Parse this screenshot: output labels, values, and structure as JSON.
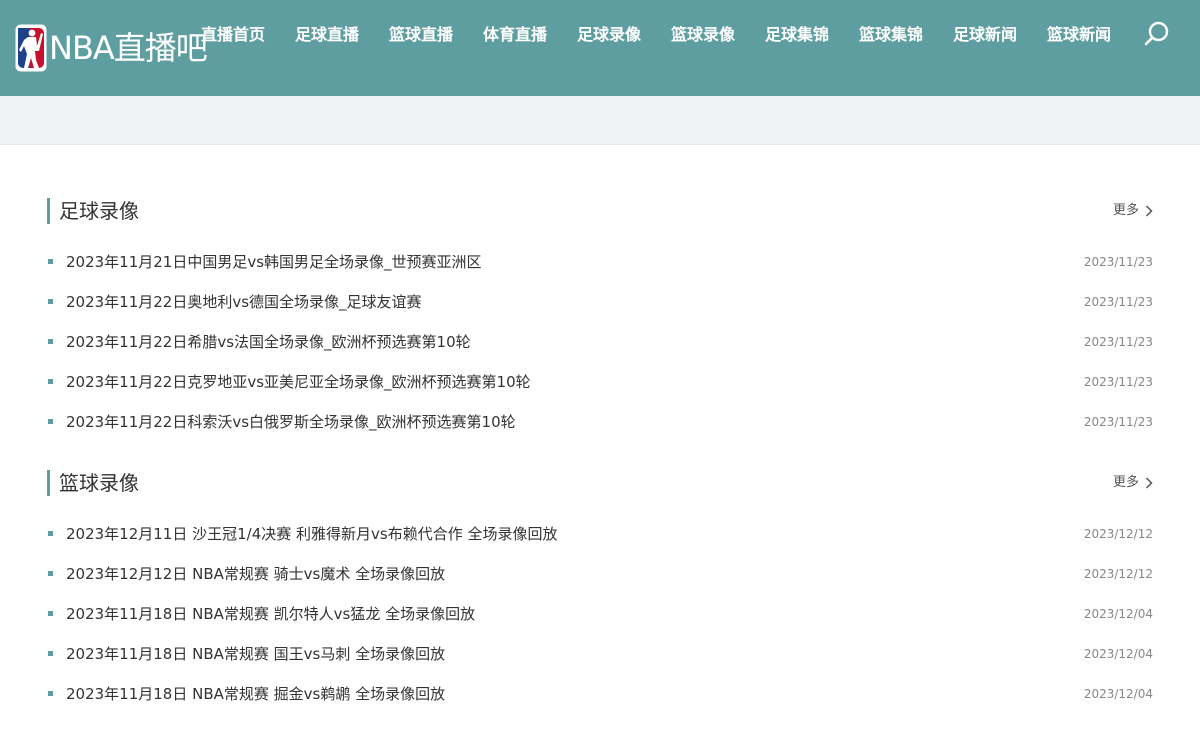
{
  "colors": {
    "brand": "#5f9ea0",
    "band": "#f1f2f6",
    "text": "#333333",
    "date": "#888888"
  },
  "header": {
    "logo_text": "NBA直播吧",
    "logo_icon": "nba-logo-icon",
    "nav": [
      {
        "label": "直播首页"
      },
      {
        "label": "足球直播"
      },
      {
        "label": "篮球直播"
      },
      {
        "label": "体育直播"
      },
      {
        "label": "足球录像"
      },
      {
        "label": "篮球录像"
      },
      {
        "label": "足球集锦"
      },
      {
        "label": "篮球集锦"
      },
      {
        "label": "足球新闻"
      },
      {
        "label": "篮球新闻"
      }
    ],
    "search_icon": "search-icon"
  },
  "sections": [
    {
      "title": "足球录像",
      "more_label": "更多",
      "items": [
        {
          "title": "2023年11月21日中国男足vs韩国男足全场录像_世预赛亚洲区",
          "date": "2023/11/23"
        },
        {
          "title": "2023年11月22日奥地利vs德国全场录像_足球友谊赛",
          "date": "2023/11/23"
        },
        {
          "title": "2023年11月22日希腊vs法国全场录像_欧洲杯预选赛第10轮",
          "date": "2023/11/23"
        },
        {
          "title": "2023年11月22日克罗地亚vs亚美尼亚全场录像_欧洲杯预选赛第10轮",
          "date": "2023/11/23"
        },
        {
          "title": "2023年11月22日科索沃vs白俄罗斯全场录像_欧洲杯预选赛第10轮",
          "date": "2023/11/23"
        }
      ]
    },
    {
      "title": "篮球录像",
      "more_label": "更多",
      "items": [
        {
          "title": "2023年12月11日 沙王冠1/4决赛 利雅得新月vs布赖代合作 全场录像回放",
          "date": "2023/12/12"
        },
        {
          "title": "2023年12月12日 NBA常规赛 骑士vs魔术 全场录像回放",
          "date": "2023/12/12"
        },
        {
          "title": "2023年11月18日 NBA常规赛 凯尔特人vs猛龙 全场录像回放",
          "date": "2023/12/04"
        },
        {
          "title": "2023年11月18日 NBA常规赛 国王vs马刺 全场录像回放",
          "date": "2023/12/04"
        },
        {
          "title": "2023年11月18日 NBA常规赛 掘金vs鹈鹕 全场录像回放",
          "date": "2023/12/04"
        }
      ]
    }
  ]
}
